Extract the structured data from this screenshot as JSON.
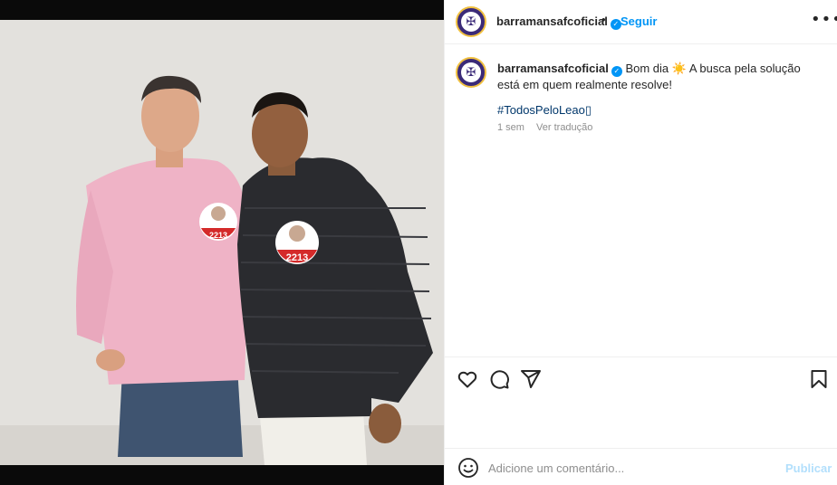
{
  "header": {
    "username": "barramansafcoficial",
    "separator": "•",
    "follow_label": "Seguir",
    "more_label": "•••"
  },
  "caption": {
    "username": "barramansafcoficial",
    "text": "Bom dia ☀️ A busca pela solução está em quem realmente resolve!",
    "hashtag": "#TodosPeloLeao▯",
    "time": "1 sem",
    "translate_label": "Ver tradução"
  },
  "photo": {
    "badge_number_left": "2213",
    "badge_number_right": "2213"
  },
  "comment": {
    "placeholder": "Adicione um comentário...",
    "post_label": "Publicar"
  },
  "colors": {
    "accent": "#0095f6",
    "hashtag": "#00376b",
    "muted": "#8e8e8e",
    "post_disabled": "#b2dffc",
    "avatar_purple": "#3b2a78"
  },
  "icons": [
    "heart-icon",
    "comment-icon",
    "share-icon",
    "bookmark-icon",
    "emoji-icon",
    "verified-icon",
    "more-icon"
  ]
}
